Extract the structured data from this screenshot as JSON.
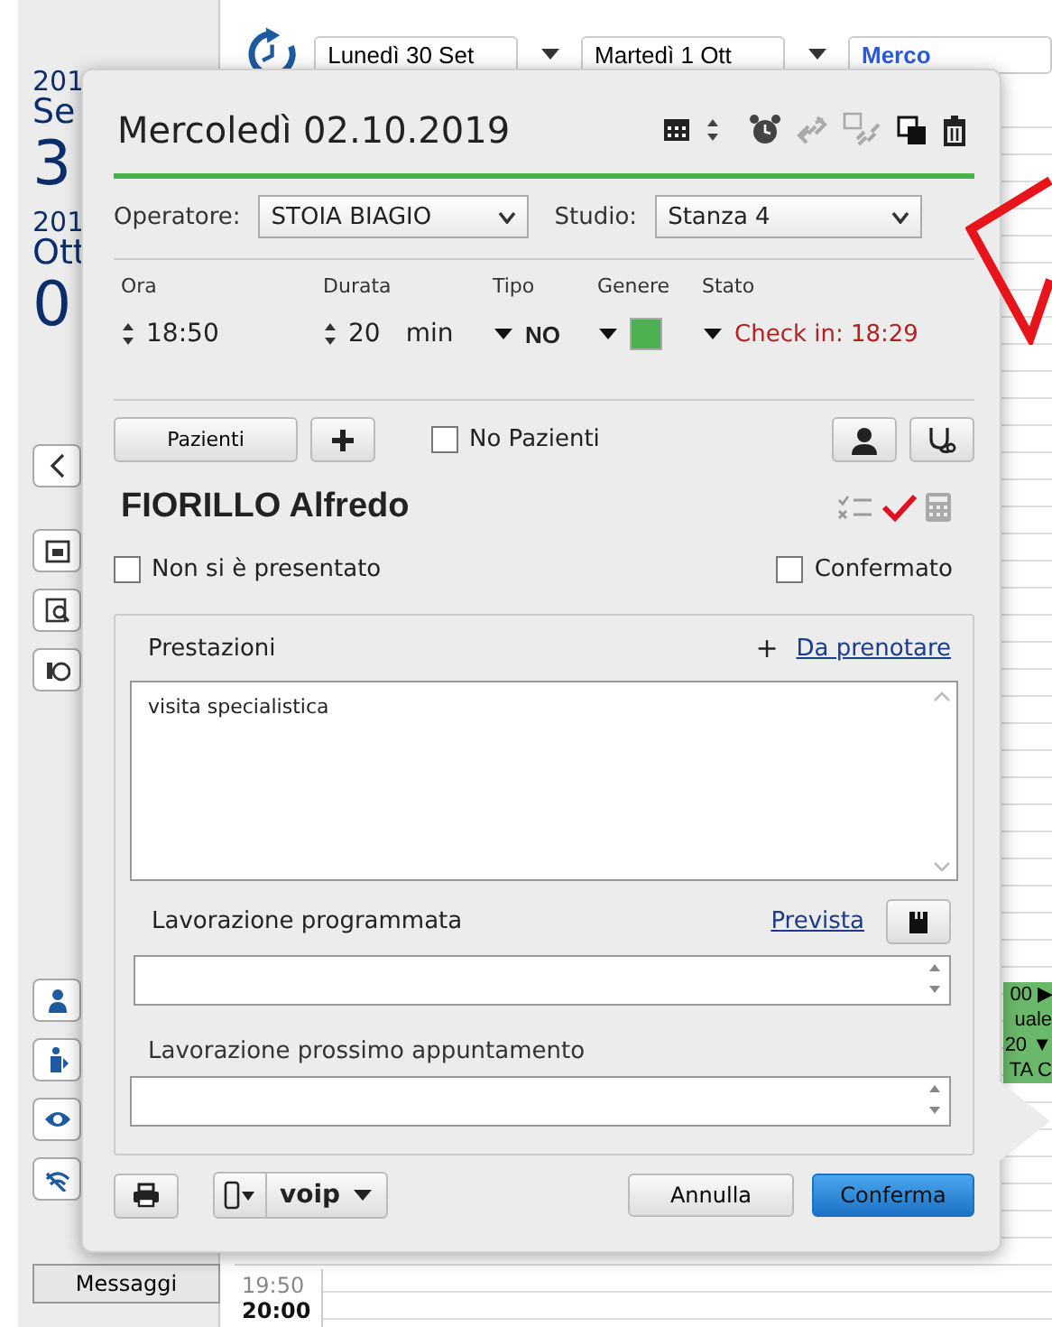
{
  "background": {
    "date_blocks": [
      {
        "year": "201",
        "month": "Se",
        "day": "3"
      },
      {
        "year": "201",
        "month": "Ott",
        "day": "0"
      }
    ],
    "messages_button": "Messaggi",
    "day_selectors": [
      {
        "label": "Lunedì 30 Set",
        "selected": false
      },
      {
        "label": "Martedì 1 Ott",
        "selected": false
      },
      {
        "label": "Merco",
        "selected": true
      }
    ],
    "times": [
      {
        "label": "19:50",
        "current": false
      },
      {
        "label": "20:00",
        "current": true
      }
    ],
    "appointment_fragments": [
      "00 ▶",
      "uale",
      "20 ▼",
      "TA C"
    ]
  },
  "dialog": {
    "title": "Mercoledì 02.10.2019",
    "operator_label": "Operatore:",
    "operator_value": "STOIA BIAGIO",
    "studio_label": "Studio:",
    "studio_value": "Stanza 4",
    "fields": [
      {
        "kind": "spin",
        "label": "Ora",
        "value": "18:50"
      },
      {
        "kind": "spin",
        "label": "Durata",
        "value": "20",
        "unit": "min"
      },
      {
        "kind": "drop",
        "label": "Tipo",
        "value": "NO"
      },
      {
        "kind": "color",
        "label": "Genere",
        "color": "#4caf50"
      },
      {
        "kind": "status",
        "label": "Stato",
        "value": "Check in: 18:29"
      }
    ],
    "patients_button": "Pazienti",
    "no_patients": {
      "label": "No Pazienti",
      "checked": false
    },
    "patient_name": "FIORILLO Alfredo",
    "checkboxes": [
      {
        "label": "Non si è presentato",
        "checked": false
      },
      {
        "label": "Confermato",
        "checked": false
      }
    ],
    "services_label": "Prestazioni",
    "services_add": "+",
    "services_link": "Da prenotare",
    "services_value": "visita specialistica",
    "planned_label": "Lavorazione programmata",
    "planned_link": "Prevista",
    "next_label": "Lavorazione prossimo appuntamento",
    "voip": "voip",
    "cancel": "Annulla",
    "confirm": "Conferma"
  }
}
